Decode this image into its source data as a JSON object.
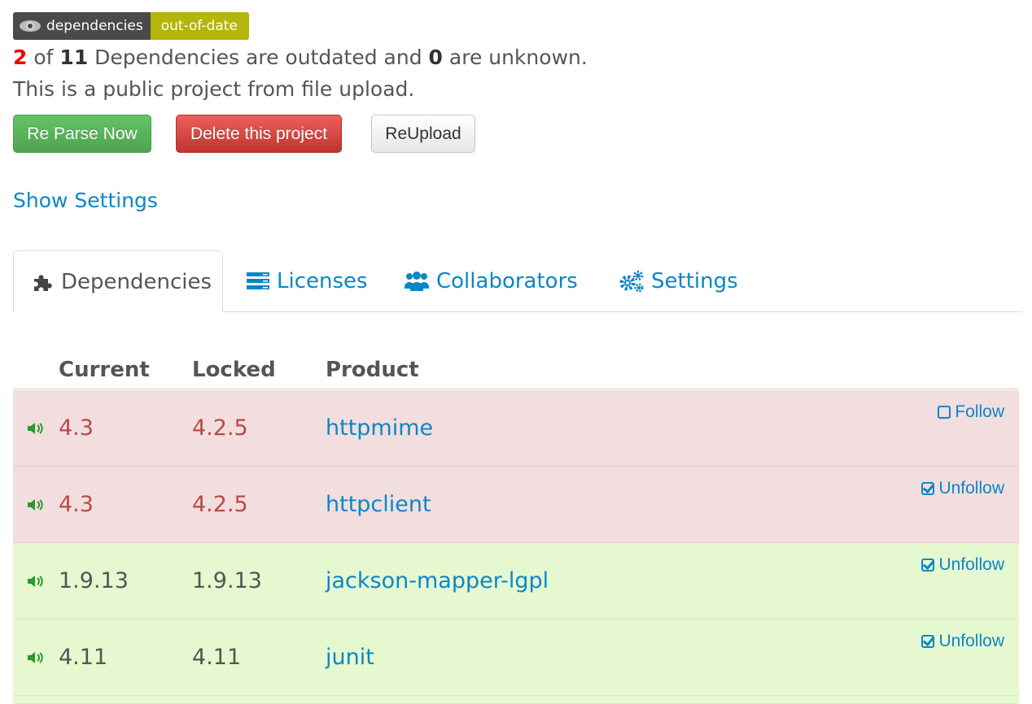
{
  "badge": {
    "left": "dependencies",
    "right": "out-of-date",
    "left_color": "#4a4a4a",
    "right_color": "#b5b50b"
  },
  "summary": {
    "outdated_count": "2",
    "of": "of",
    "total": "11",
    "mid": "Dependencies are outdated and",
    "unknown": "0",
    "end": "are unknown."
  },
  "subtitle": "This is a public project from file upload.",
  "buttons": {
    "reparse": "Re Parse Now",
    "delete": "Delete this project",
    "reupload": "ReUpload"
  },
  "show_settings": "Show Settings",
  "tabs": [
    {
      "label": "Dependencies",
      "icon": "puzzle-icon",
      "active": true
    },
    {
      "label": "Licenses",
      "icon": "list-icon",
      "active": false
    },
    {
      "label": "Collaborators",
      "icon": "group-icon",
      "active": false
    },
    {
      "label": "Settings",
      "icon": "gears-icon",
      "active": false
    }
  ],
  "table": {
    "headers": {
      "current": "Current",
      "locked": "Locked",
      "product": "Product"
    },
    "rows": [
      {
        "current": "4.3",
        "locked": "4.2.5",
        "product": "httpmime",
        "follow": "Follow",
        "following": false,
        "status": "outdated"
      },
      {
        "current": "4.3",
        "locked": "4.2.5",
        "product": "httpclient",
        "follow": "Unfollow",
        "following": true,
        "status": "outdated"
      },
      {
        "current": "1.9.13",
        "locked": "1.9.13",
        "product": "jackson-mapper-lgpl",
        "follow": "Unfollow",
        "following": true,
        "status": "current"
      },
      {
        "current": "4.11",
        "locked": "4.11",
        "product": "junit",
        "follow": "Unfollow",
        "following": true,
        "status": "current"
      }
    ]
  },
  "colors": {
    "link": "#0a87c7",
    "outdated_row": "#f2dede",
    "current_row": "#e6f8d0",
    "outdated_text": "#b94a48",
    "speaker": "#2a9a2a"
  }
}
